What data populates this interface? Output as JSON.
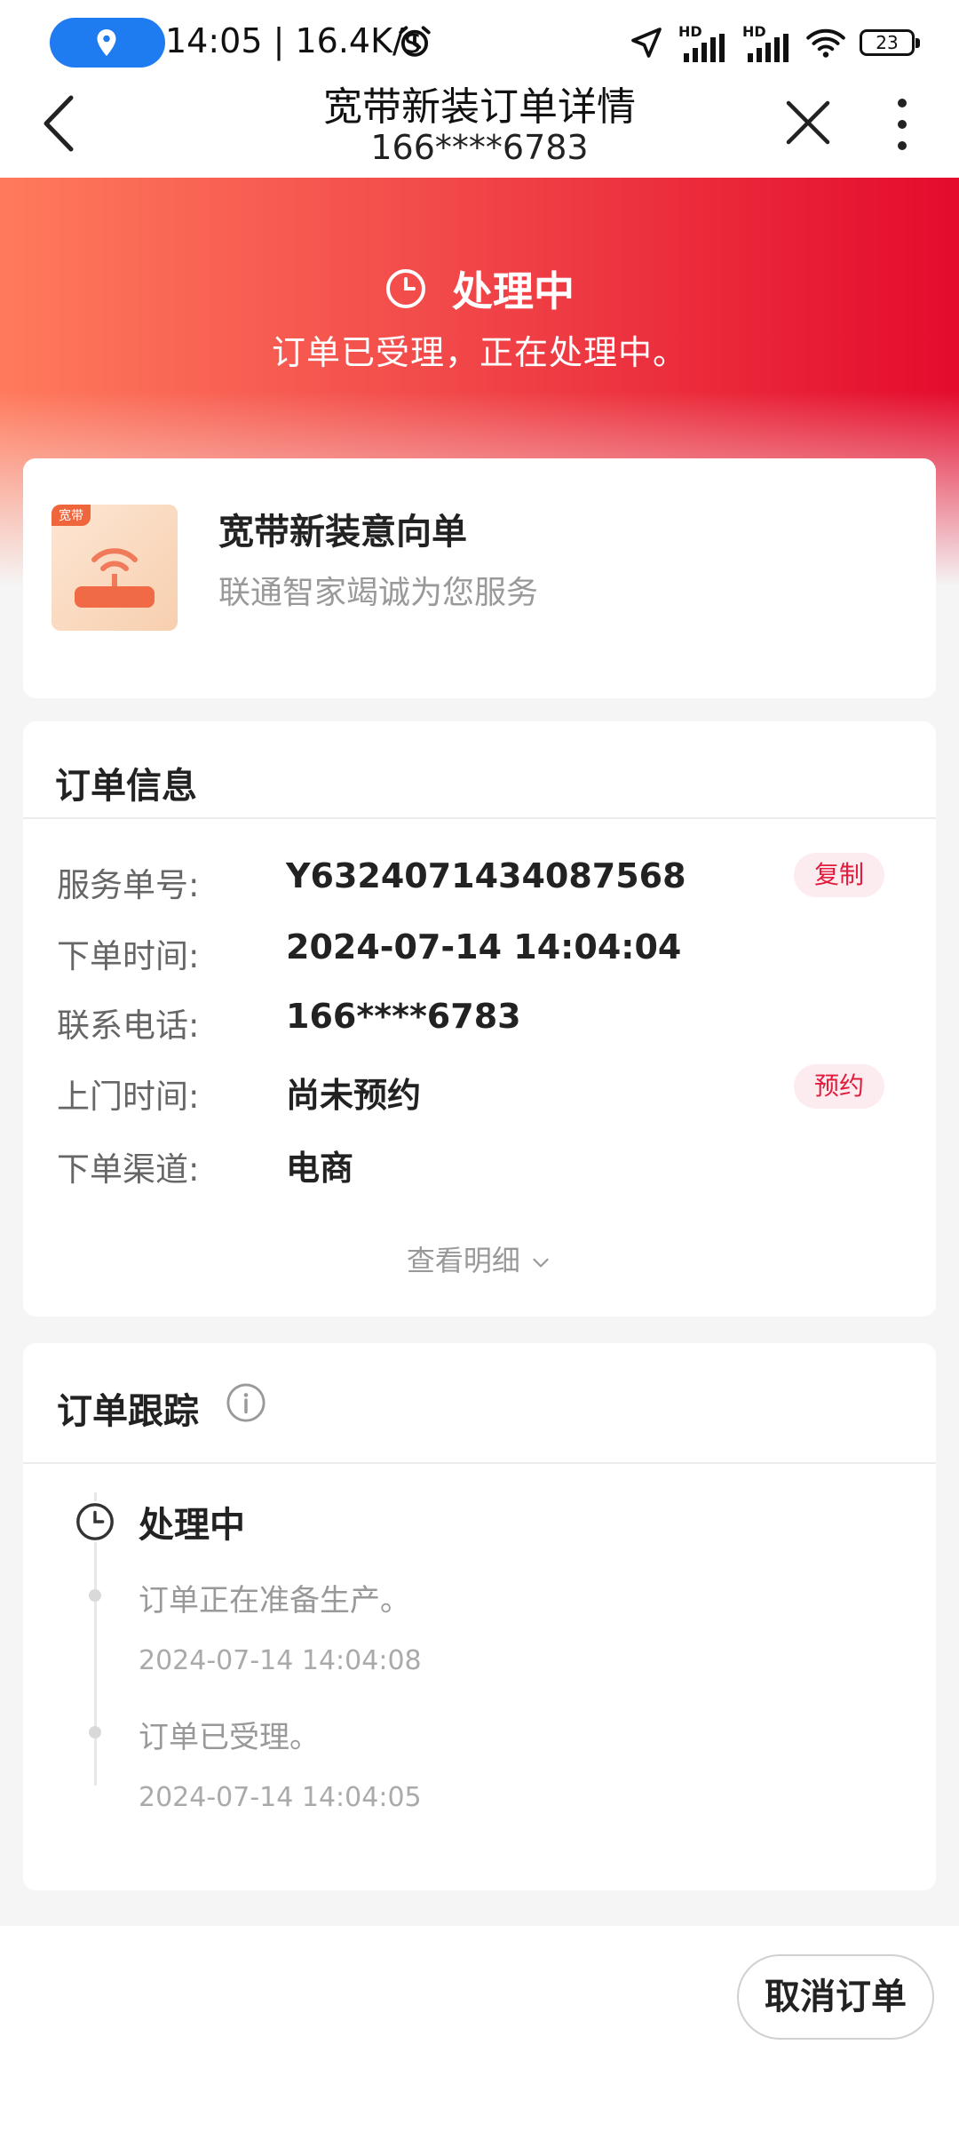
{
  "status_bar": {
    "time_speed": "14:05 | 16.4K/s",
    "network_type_1": "HD",
    "network_type_2": "HD",
    "battery": "23"
  },
  "nav": {
    "title": "宽带新装订单详情",
    "subtitle": "166****6783"
  },
  "hero": {
    "status": "处理中",
    "description": "订单已受理，正在处理中。",
    "gradient_colors": [
      "#ff7a5c",
      "#f24a4a",
      "#e40b2c"
    ]
  },
  "product": {
    "tag": "宽带",
    "title": "宽带新装意向单",
    "subtitle": "联通智家竭诚为您服务"
  },
  "order_info": {
    "heading": "订单信息",
    "rows": [
      {
        "label": "服务单号:",
        "value": "Y6324071434087568",
        "action": "复制"
      },
      {
        "label": "下单时间:",
        "value": "2024-07-14 14:04:04"
      },
      {
        "label": "联系电话:",
        "value": "166****6783"
      },
      {
        "label": "上门时间:",
        "value": "尚未预约",
        "action": "预约"
      },
      {
        "label": "下单渠道:",
        "value": "电商"
      }
    ],
    "more_label": "查看明细"
  },
  "tracking": {
    "heading": "订单跟踪",
    "current_status": "处理中",
    "events": [
      {
        "text": "订单正在准备生产。",
        "time": "2024-07-14 14:04:08"
      },
      {
        "text": "订单已受理。",
        "time": "2024-07-14 14:04:05"
      }
    ]
  },
  "footer": {
    "cancel_label": "取消订单"
  },
  "colors": {
    "accent_red": "#e01b3c",
    "location_pill": "#1e7bf0"
  }
}
